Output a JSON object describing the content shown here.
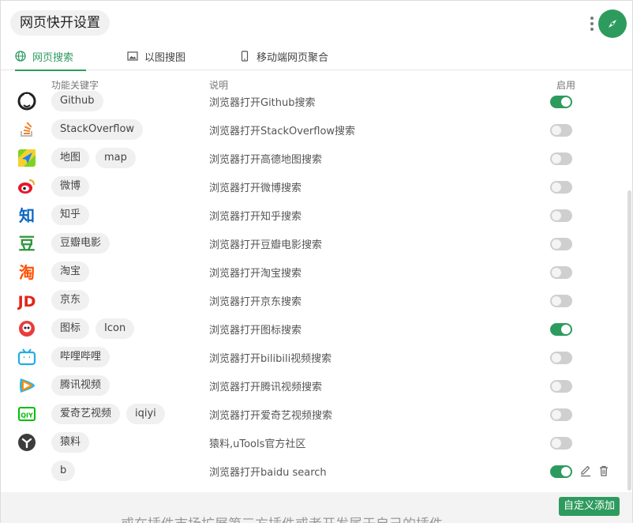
{
  "header": {
    "title": "网页快开设置"
  },
  "tabs": [
    {
      "label": "网页搜索",
      "icon": "globe-icon",
      "active": true
    },
    {
      "label": "以图搜图",
      "icon": "image-icon",
      "active": false
    },
    {
      "label": "移动端网页聚合",
      "icon": "mobile-phone-icon",
      "active": false
    }
  ],
  "columns": {
    "keywords": "功能关键字",
    "description": "说明",
    "enabled": "启用"
  },
  "rows": [
    {
      "icon": "github-icon",
      "tags": [
        "Github"
      ],
      "desc": "浏览器打开Github搜索",
      "enabled": true
    },
    {
      "icon": "stackoverflow-icon",
      "tags": [
        "StackOverflow"
      ],
      "desc": "浏览器打开StackOverflow搜索",
      "enabled": false
    },
    {
      "icon": "gaode-map-icon",
      "tags": [
        "地图",
        "map"
      ],
      "desc": "浏览器打开高德地图搜索",
      "enabled": false
    },
    {
      "icon": "weibo-icon",
      "tags": [
        "微博"
      ],
      "desc": "浏览器打开微博搜索",
      "enabled": false
    },
    {
      "icon": "zhihu-icon",
      "tags": [
        "知乎"
      ],
      "desc": "浏览器打开知乎搜索",
      "enabled": false
    },
    {
      "icon": "douban-icon",
      "tags": [
        "豆瓣电影"
      ],
      "desc": "浏览器打开豆瓣电影搜索",
      "enabled": false
    },
    {
      "icon": "taobao-icon",
      "tags": [
        "淘宝"
      ],
      "desc": "浏览器打开淘宝搜索",
      "enabled": false
    },
    {
      "icon": "jd-icon",
      "tags": [
        "京东"
      ],
      "desc": "浏览器打开京东搜索",
      "enabled": false
    },
    {
      "icon": "iconfont-icon",
      "tags": [
        "图标",
        "Icon"
      ],
      "desc": "浏览器打开图标搜索",
      "enabled": true
    },
    {
      "icon": "bilibili-icon",
      "tags": [
        "哔哩哔哩"
      ],
      "desc": "浏览器打开bilibili视频搜索",
      "enabled": false
    },
    {
      "icon": "tencent-video-icon",
      "tags": [
        "腾讯视频"
      ],
      "desc": "浏览器打开腾讯视频搜索",
      "enabled": false
    },
    {
      "icon": "iqiyi-icon",
      "tags": [
        "爱奇艺视频",
        "iqiyi"
      ],
      "desc": "浏览器打开爱奇艺视频搜索",
      "enabled": false
    },
    {
      "icon": "yuanliao-icon",
      "tags": [
        "猿料"
      ],
      "desc": "猿料,uTools官方社区",
      "enabled": false
    },
    {
      "icon": "",
      "tags": [
        "b"
      ],
      "desc": "浏览器打开baidu search",
      "enabled": true,
      "custom": true
    }
  ],
  "footer": {
    "add_label": "自定义添加",
    "background_text": "或在插件市场扩展第三方插件或者开发属于自己的插件。"
  },
  "colors": {
    "accent": "#2e9b5e",
    "toggle_off": "#cfcfcf",
    "tag_bg": "#f0f0f0"
  }
}
